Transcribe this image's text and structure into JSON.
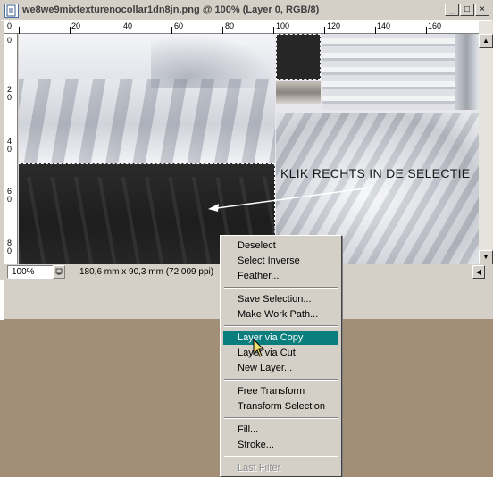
{
  "window": {
    "title": "we8we9mixtexturenocollar1dn8jn.png @ 100% (Layer 0, RGB/8)",
    "buttons": {
      "minimize": "_",
      "maximize": "□",
      "close": "×"
    }
  },
  "ruler": {
    "top_labels": [
      "0",
      "20",
      "40",
      "60",
      "80",
      "100",
      "120",
      "140",
      "160"
    ],
    "left_labels": [
      "0",
      "2\n0",
      "4\n0",
      "6\n0",
      "8\n0"
    ]
  },
  "annotation": {
    "text": "KLIK RECHTS IN DE SELECTIE"
  },
  "statusbar": {
    "zoom": "100%",
    "doc_info": "180,6 mm x 90,3 mm (72,009 ppi)"
  },
  "context_menu": {
    "items": [
      {
        "label": "Deselect",
        "state": "normal"
      },
      {
        "label": "Select Inverse",
        "state": "normal"
      },
      {
        "label": "Feather...",
        "state": "normal"
      },
      {
        "label": "Save Selection...",
        "state": "normal"
      },
      {
        "label": "Make Work Path...",
        "state": "normal"
      },
      {
        "label": "Layer via Copy",
        "state": "highlighted"
      },
      {
        "label": "Layer via Cut",
        "state": "normal"
      },
      {
        "label": "New Layer...",
        "state": "normal"
      },
      {
        "label": "Free Transform",
        "state": "normal"
      },
      {
        "label": "Transform Selection",
        "state": "normal"
      },
      {
        "label": "Fill...",
        "state": "normal"
      },
      {
        "label": "Stroke...",
        "state": "normal"
      },
      {
        "label": "Last Filter",
        "state": "disabled"
      }
    ]
  },
  "colors": {
    "desktop": "#a38f78",
    "chrome": "#d4d0c8",
    "menu_highlight": "#0a7d7d",
    "selection_dark_fabric": "#262626"
  },
  "icons": [
    "document-icon",
    "minimize-icon",
    "maximize-icon",
    "close-icon",
    "scroll-up-icon",
    "scroll-down-icon",
    "scroll-left-icon",
    "nav-icon",
    "cursor-arrow-icon"
  ]
}
